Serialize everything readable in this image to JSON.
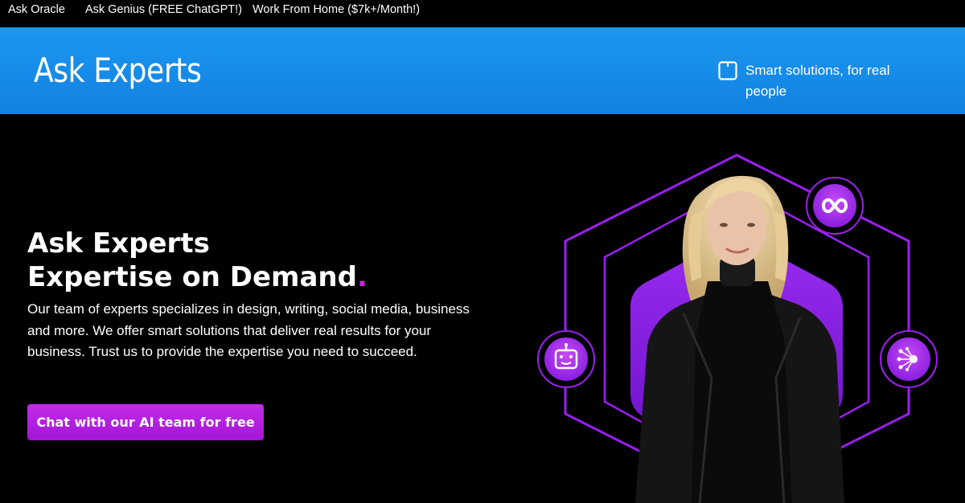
{
  "topnav": {
    "items": [
      {
        "label": "Ask Oracle"
      },
      {
        "label": "Ask Genius (FREE ChatGPT!)"
      },
      {
        "label": "Work From Home ($7k+/Month!)"
      }
    ]
  },
  "header": {
    "brand": "Ask Experts",
    "tagline": "Smart solutions, for real people",
    "tagline_icon": "square-outline-icon"
  },
  "hero": {
    "title_line1": "Ask Experts",
    "title_line2": "Expertise on Demand",
    "title_dot": ".",
    "description": "Our team of experts specializes in design, writing, social media, business and more. We offer smart solutions that deliver real results for your business. Trust us to provide the expertise you need to succeed.",
    "cta_label": "Chat with our AI team for free"
  },
  "colors": {
    "header_blue": "#1a97f0",
    "accent_purple": "#b020e0",
    "dot_magenta": "#d020e8",
    "background": "#000000"
  },
  "icons": {
    "top_badge": "infinity-icon",
    "left_badge": "robot-icon",
    "right_badge": "network-icon"
  }
}
